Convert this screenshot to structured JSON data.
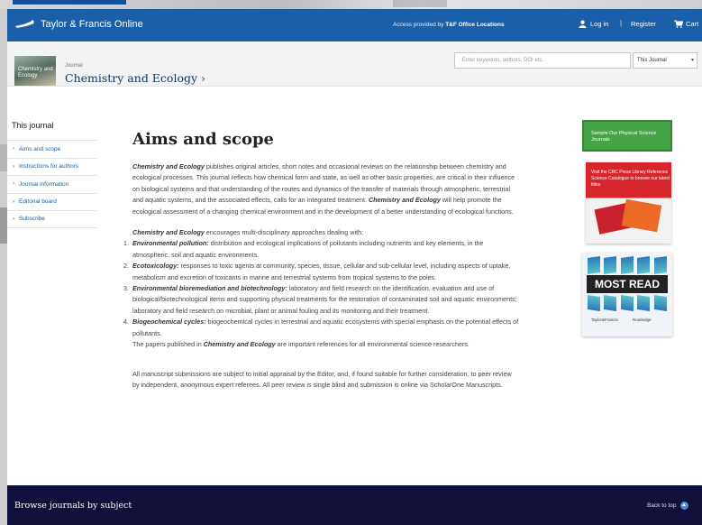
{
  "header": {
    "brand": "Taylor & Francis Online",
    "access_prefix": "Access provided by",
    "access_org": "T&F Office Locations",
    "login": "Log in",
    "separator": "|",
    "register": "Register",
    "cart": "Cart"
  },
  "journal_bar": {
    "cover_text": "Chemistry and Ecology",
    "label": "Journal",
    "title": "Chemistry and Ecology ›",
    "search_placeholder": "Enter keywords, authors, DOI etc.",
    "scope_value": "This Journal"
  },
  "sidebar": {
    "heading": "This journal",
    "items": [
      {
        "label": "Aims and scope"
      },
      {
        "label": "Instructions for authors"
      },
      {
        "label": "Journal information"
      },
      {
        "label": "Editorial board"
      },
      {
        "label": "Subscribe"
      }
    ]
  },
  "main": {
    "title": "Aims and scope",
    "p1_em": "Chemistry and Ecology",
    "p1_text": " publishes original articles, short notes and occasional reviews on the relationship between chemistry and ecological processes. This journal reflects how chemical form and state, as well as other basic properties, are critical in their influence on biological systems and that understanding of the routes and dynamics of the transfer of materials through atmospheric, terrestrial and aquatic systems, and the associated effects, calls for an integrated treatment. ",
    "p1_em2": "Chemistry and Ecology",
    "p1_text2": " will help promote the ecological assessment of a changing chemical environment and in the development of a better understanding of ecological functions.",
    "p2_em": "Chemistry and Ecology",
    "p2_text": " encourages multi-disciplinary approaches dealing with:",
    "list": [
      {
        "num": "1.",
        "head": "Environmental pollution:",
        "text": " distribution and ecological implications of pollutants including nutrients and key elements, in the atmospheric, soil and aquatic environments."
      },
      {
        "num": "2.",
        "head": "Ecotoxicology:",
        "text": " responses to toxic agents at community, species, tissue, cellular and sub-cellular level, including aspects of uptake, metabolism and excretion of toxicants in marine and terrestrial systems from tropical systems to the poles."
      },
      {
        "num": "3.",
        "head": "Environmental bioremediation and biotechnology:",
        "text": " laboratory and field research on the identification, evaluation and use of biological/biotechnological items and supporting physical treatments for the restoration of contaminated soil and aquatic environments; laboratory and field research on microbial, plant or animal fouling and its monitoring and their treatment."
      },
      {
        "num": "4.",
        "head": "Biogeochemical cycles:",
        "text": " biogeochemical cycles in terrestrial and aquatic ecosystems with special emphasis on the potential effects of pollutants."
      }
    ],
    "p3_text1": "The papers published in ",
    "p3_em": "Chemistry and Ecology",
    "p3_text2": " are important references for all environmental science researchers.",
    "p4": "All manuscript submissions are subject to initial appraisal by the Editor, and, if found suitable for further consideration, to peer review by independent, anonymous expert referees. All peer review is single blind and submission is online via ScholarOne Manuscripts."
  },
  "ads": {
    "ad1": "Sample Our Physical Science Journals",
    "ad2": "Visit the CRC Press Library Reference Science Catalogue to browse our latest titles",
    "ad3_title": "MOST READ",
    "ad3_logo1": "Taylor&Francis",
    "ad3_logo2": "Routledge"
  },
  "footer": {
    "title": "Browse journals by subject",
    "back_to_top": "Back to top",
    "back_icon": "▲"
  }
}
